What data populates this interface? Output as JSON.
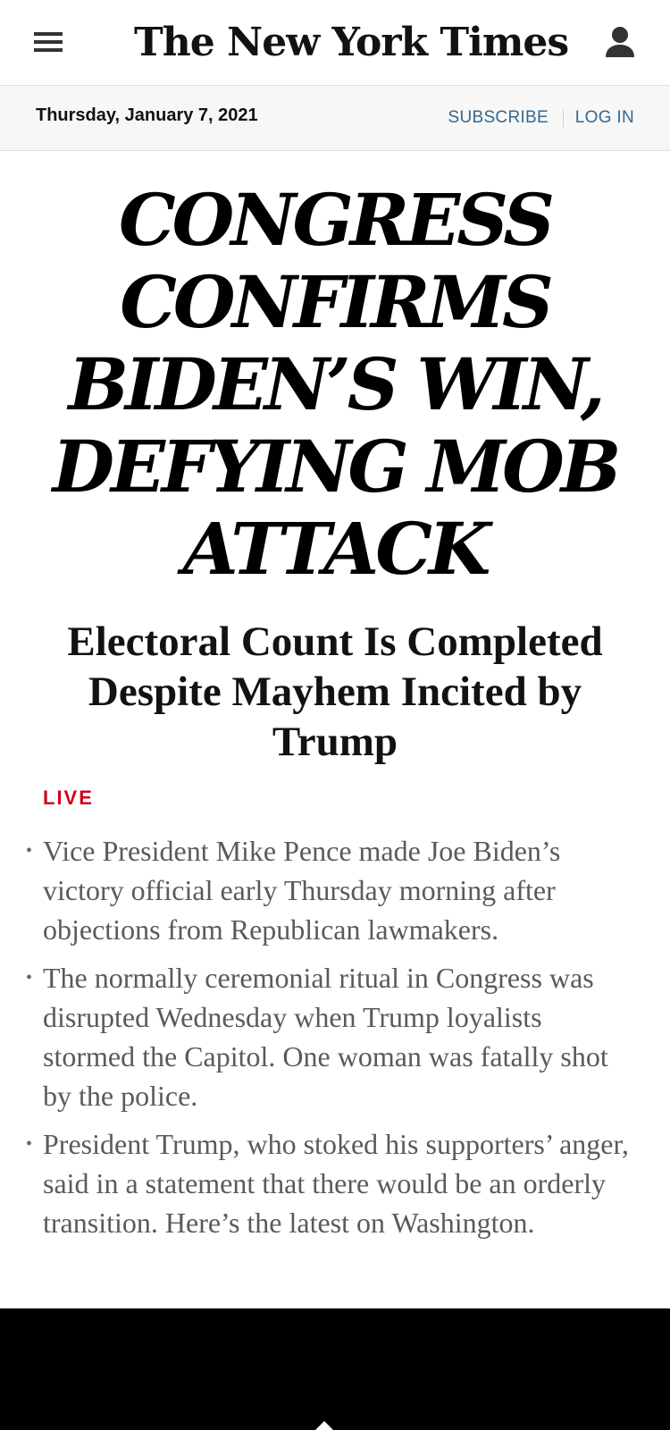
{
  "header": {
    "logo_text": "The New York Times",
    "menu_icon": "menu-icon",
    "user_icon": "user-icon"
  },
  "subbar": {
    "date": "Thursday, January 7, 2021",
    "subscribe_label": "SUBSCRIBE",
    "login_label": "LOG IN"
  },
  "article": {
    "headline": "CONGRESS CONFIRMS BIDEN’S WIN, DEFYING MOB ATTACK",
    "subheadline": "Electoral Count Is Completed Despite Mayhem Incited by Trump",
    "live_label": "LIVE",
    "bullets": [
      "Vice President Mike Pence made Joe Biden’s victory official early Thursday morning after objections from Republican lawmakers.",
      "The normally ceremonial ritual in Congress was disrupted Wednesday when Trump loyalists stormed the Capitol. One woman was fatally shot by the police.",
      "President Trump, who stoked his supporters’ anger, said in a statement that there would be an orderly transition. Here’s the latest on Washington."
    ]
  },
  "colors": {
    "link": "#326891",
    "live": "#d0021b",
    "text": "#121212",
    "summary_text": "#5a5a5a"
  }
}
